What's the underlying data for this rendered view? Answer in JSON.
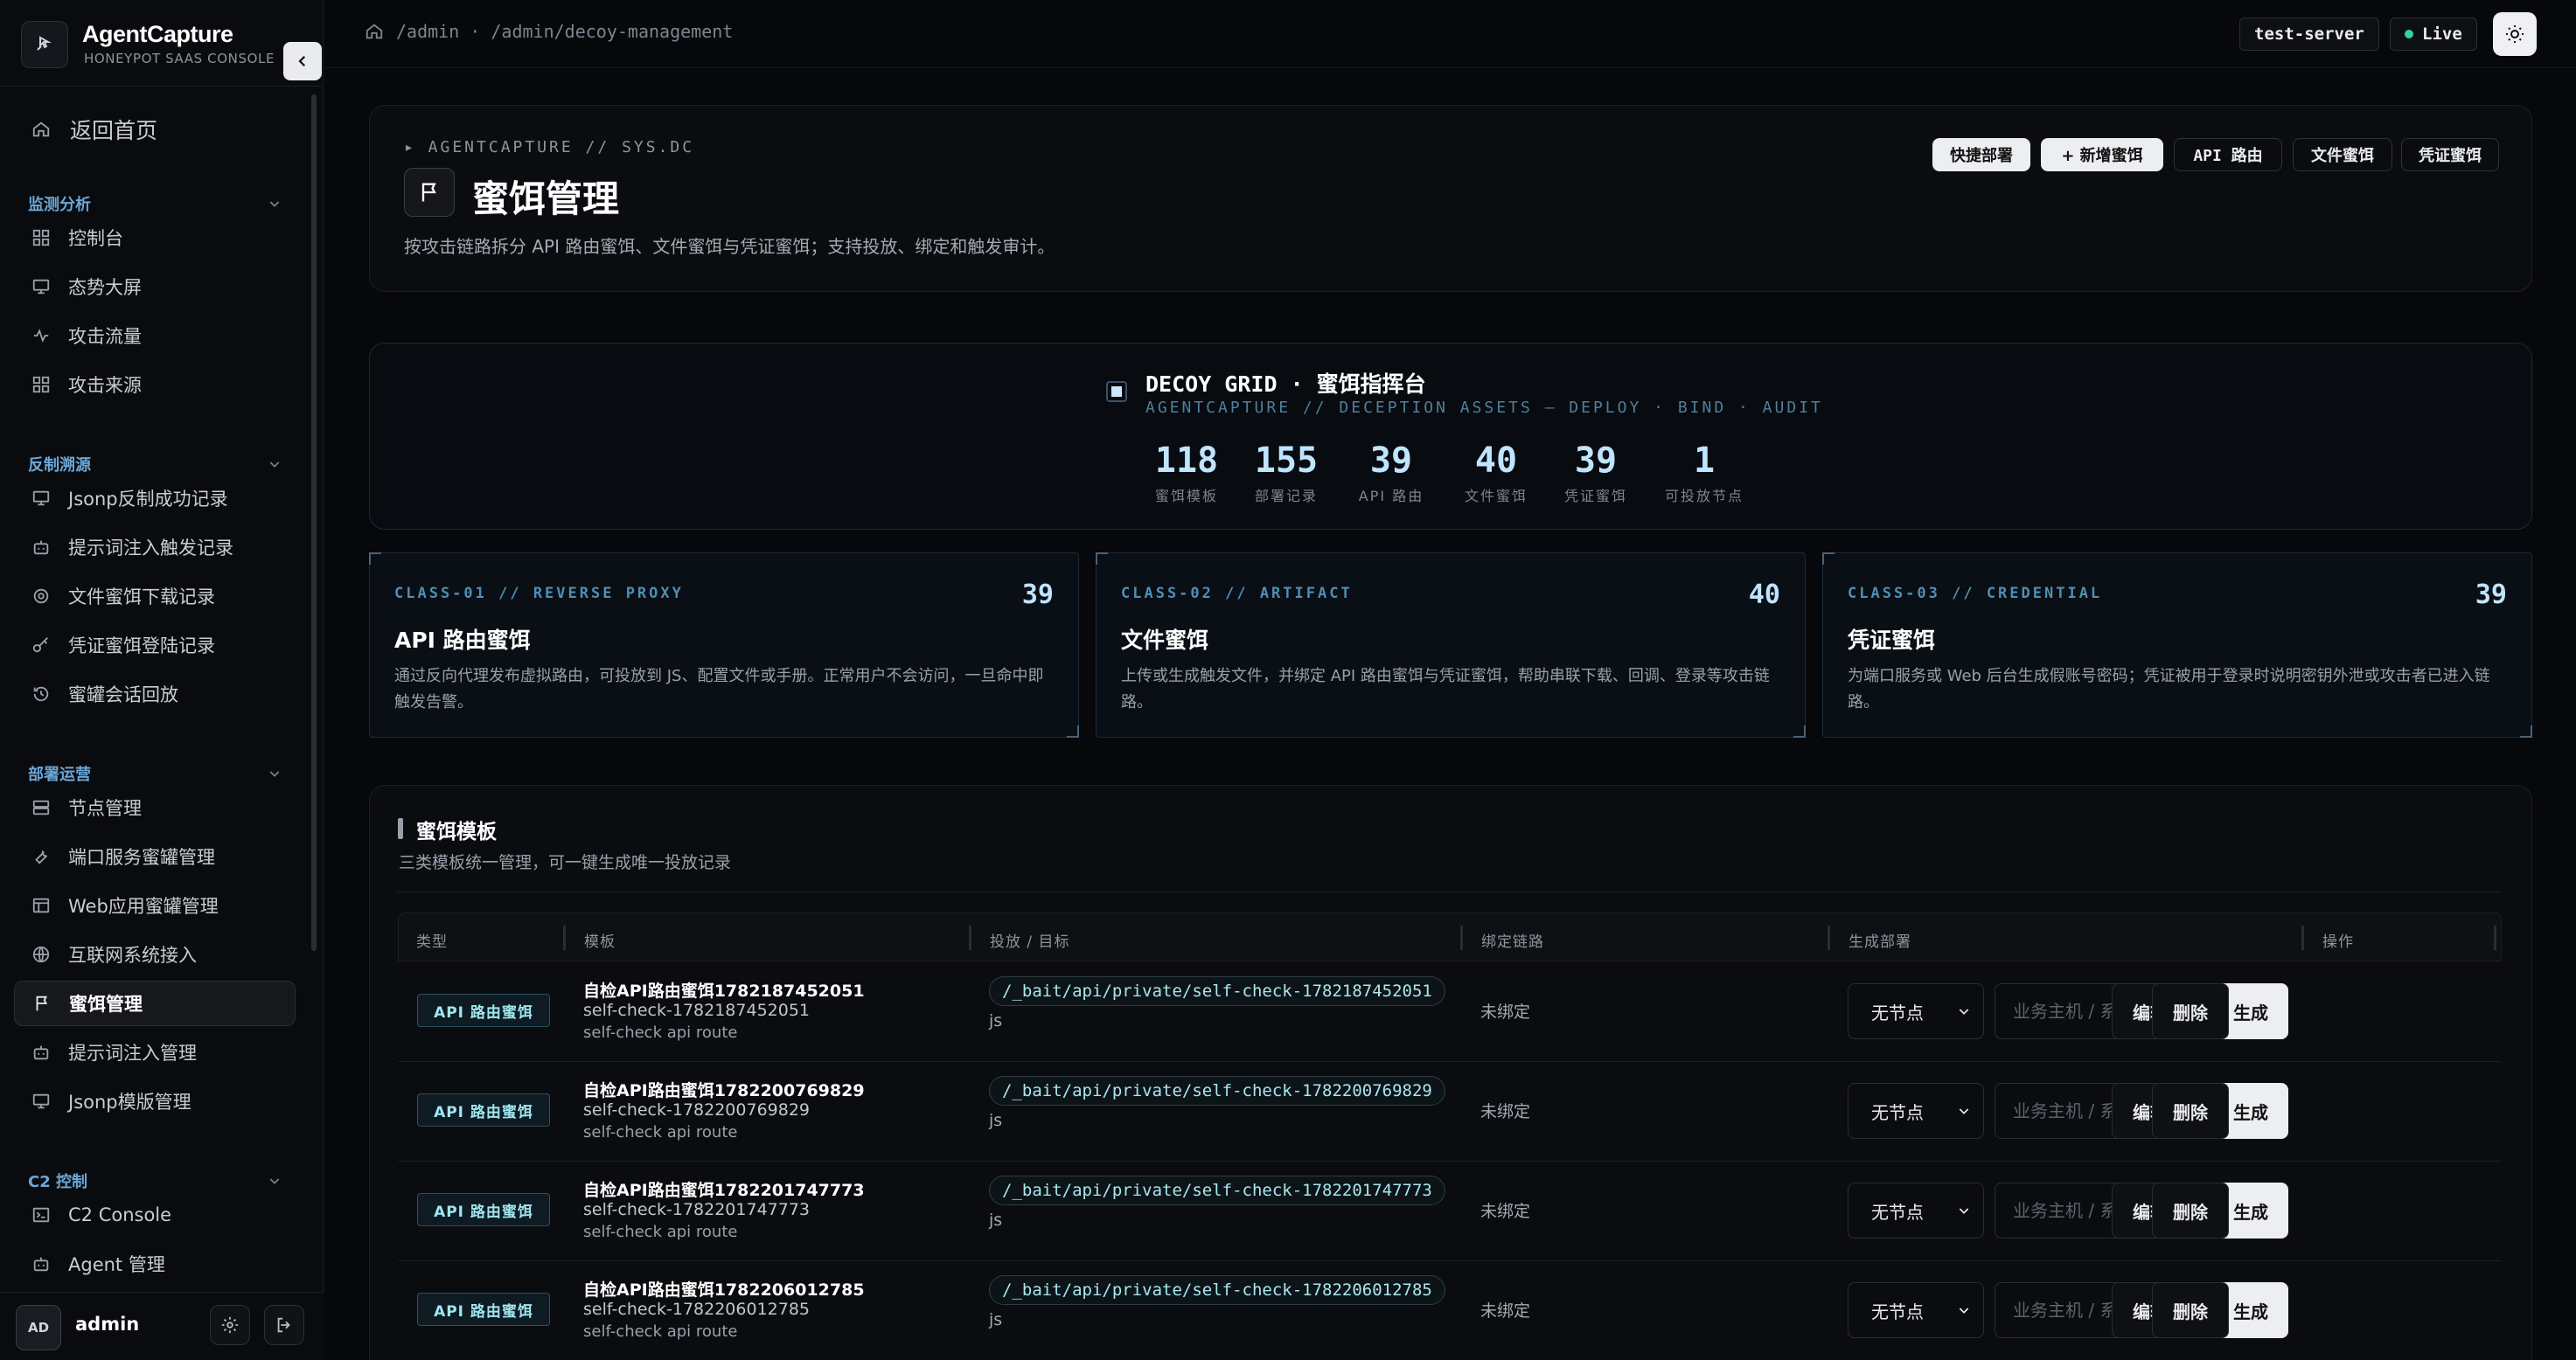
{
  "brand": {
    "name": "AgentCapture",
    "subtitle": "HONEYPOT SAAS CONSOLE"
  },
  "sidebar": {
    "home": "返回首页",
    "groups": [
      {
        "label": "监测分析",
        "items": [
          "控制台",
          "态势大屏",
          "攻击流量",
          "攻击来源"
        ]
      },
      {
        "label": "反制溯源",
        "items": [
          "Jsonp反制成功记录",
          "提示词注入触发记录",
          "文件蜜饵下载记录",
          "凭证蜜饵登陆记录",
          "蜜罐会话回放"
        ]
      },
      {
        "label": "部署运营",
        "items": [
          "节点管理",
          "端口服务蜜罐管理",
          "Web应用蜜罐管理",
          "互联网系统接入",
          "蜜饵管理",
          "提示词注入管理",
          "Jsonp模版管理"
        ]
      },
      {
        "label": "C2 控制",
        "items": [
          "C2 Console",
          "Agent 管理"
        ]
      }
    ],
    "active_item": "蜜饵管理",
    "user": {
      "initials": "AD",
      "name": "admin"
    }
  },
  "topbar": {
    "breadcrumb": "/admin · /admin/decoy-management",
    "server": "test-server",
    "status": "Live"
  },
  "hero": {
    "kicker": "▸ AGENTCAPTURE // SYS.DC",
    "title": "蜜饵管理",
    "description": "按攻击链路拆分 API 路由蜜饵、文件蜜饵与凭证蜜饵；支持投放、绑定和触发审计。",
    "actions": [
      "快捷部署",
      "+ 新增蜜饵",
      "API 路由",
      "文件蜜饵",
      "凭证蜜饵"
    ]
  },
  "grid": {
    "title": "DECOY GRID · 蜜饵指挥台",
    "subtitle": "AGENTCAPTURE // DECEPTION ASSETS — DEPLOY · BIND · AUDIT",
    "stats": [
      {
        "value": "118",
        "label": "蜜饵模板"
      },
      {
        "value": "155",
        "label": "部署记录"
      },
      {
        "value": "39",
        "label": "API 路由"
      },
      {
        "value": "40",
        "label": "文件蜜饵"
      },
      {
        "value": "39",
        "label": "凭证蜜饵"
      },
      {
        "value": "1",
        "label": "可投放节点"
      }
    ]
  },
  "classes": [
    {
      "tag": "CLASS-01 // REVERSE PROXY",
      "count": "39",
      "title": "API 路由蜜饵",
      "desc": "通过反向代理发布虚拟路由，可投放到 JS、配置文件或手册。正常用户不会访问，一旦命中即触发告警。"
    },
    {
      "tag": "CLASS-02 // ARTIFACT",
      "count": "40",
      "title": "文件蜜饵",
      "desc": "上传或生成触发文件，并绑定 API 路由蜜饵与凭证蜜饵，帮助串联下载、回调、登录等攻击链路。"
    },
    {
      "tag": "CLASS-03 // CREDENTIAL",
      "count": "39",
      "title": "凭证蜜饵",
      "desc": "为端口服务或 Web 后台生成假账号密码；凭证被用于登录时说明密钥外泄或攻击者已进入链路。"
    }
  ],
  "templates": {
    "title": "蜜饵模板",
    "subtitle": "三类模板统一管理，可一键生成唯一投放记录",
    "columns": [
      "类型",
      "模板",
      "投放 / 目标",
      "绑定链路",
      "生成部署",
      "操作"
    ],
    "rows": [
      {
        "type": "API 路由蜜饵",
        "name": "自检API路由蜜饵1782187452051",
        "code": "self-check-1782187452051",
        "desc": "self-check api route",
        "route": "/_bait/api/private/self-check-1782187452051",
        "target": "js",
        "bind": "未绑定",
        "node": "无节点",
        "host_placeholder": "业务主机 / 系统",
        "gen": "生成",
        "edit": "编辑",
        "delete": "删除"
      },
      {
        "type": "API 路由蜜饵",
        "name": "自检API路由蜜饵1782200769829",
        "code": "self-check-1782200769829",
        "desc": "self-check api route",
        "route": "/_bait/api/private/self-check-1782200769829",
        "target": "js",
        "bind": "未绑定",
        "node": "无节点",
        "host_placeholder": "业务主机 / 系统",
        "gen": "生成",
        "edit": "编辑",
        "delete": "删除"
      },
      {
        "type": "API 路由蜜饵",
        "name": "自检API路由蜜饵1782201747773",
        "code": "self-check-1782201747773",
        "desc": "self-check api route",
        "route": "/_bait/api/private/self-check-1782201747773",
        "target": "js",
        "bind": "未绑定",
        "node": "无节点",
        "host_placeholder": "业务主机 / 系统",
        "gen": "生成",
        "edit": "编辑",
        "delete": "删除"
      },
      {
        "type": "API 路由蜜饵",
        "name": "自检API路由蜜饵1782206012785",
        "code": "self-check-1782206012785",
        "desc": "self-check api route",
        "route": "/_bait/api/private/self-check-1782206012785",
        "target": "js",
        "bind": "未绑定",
        "node": "无节点",
        "host_placeholder": "业务主机 / 系统",
        "gen": "生成",
        "edit": "编辑",
        "delete": "删除"
      }
    ]
  }
}
